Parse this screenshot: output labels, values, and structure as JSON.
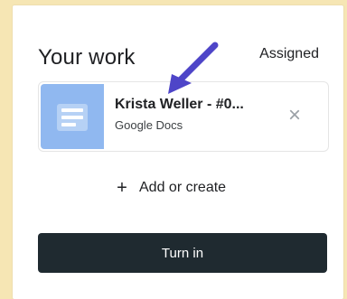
{
  "work_card": {
    "title": "Your work",
    "status": "Assigned"
  },
  "attachment": {
    "name": "Krista Weller - #0...",
    "type": "Google Docs",
    "icon": "google-docs-icon",
    "remove_icon": "close-icon"
  },
  "actions": {
    "add_or_create": "Add or create",
    "turn_in": "Turn in"
  },
  "colors": {
    "background": "#f6e6b4",
    "docs_thumbnail": "#90b8f0",
    "turn_in_button": "#1f2a30",
    "annotation_arrow": "#4e45c8"
  }
}
